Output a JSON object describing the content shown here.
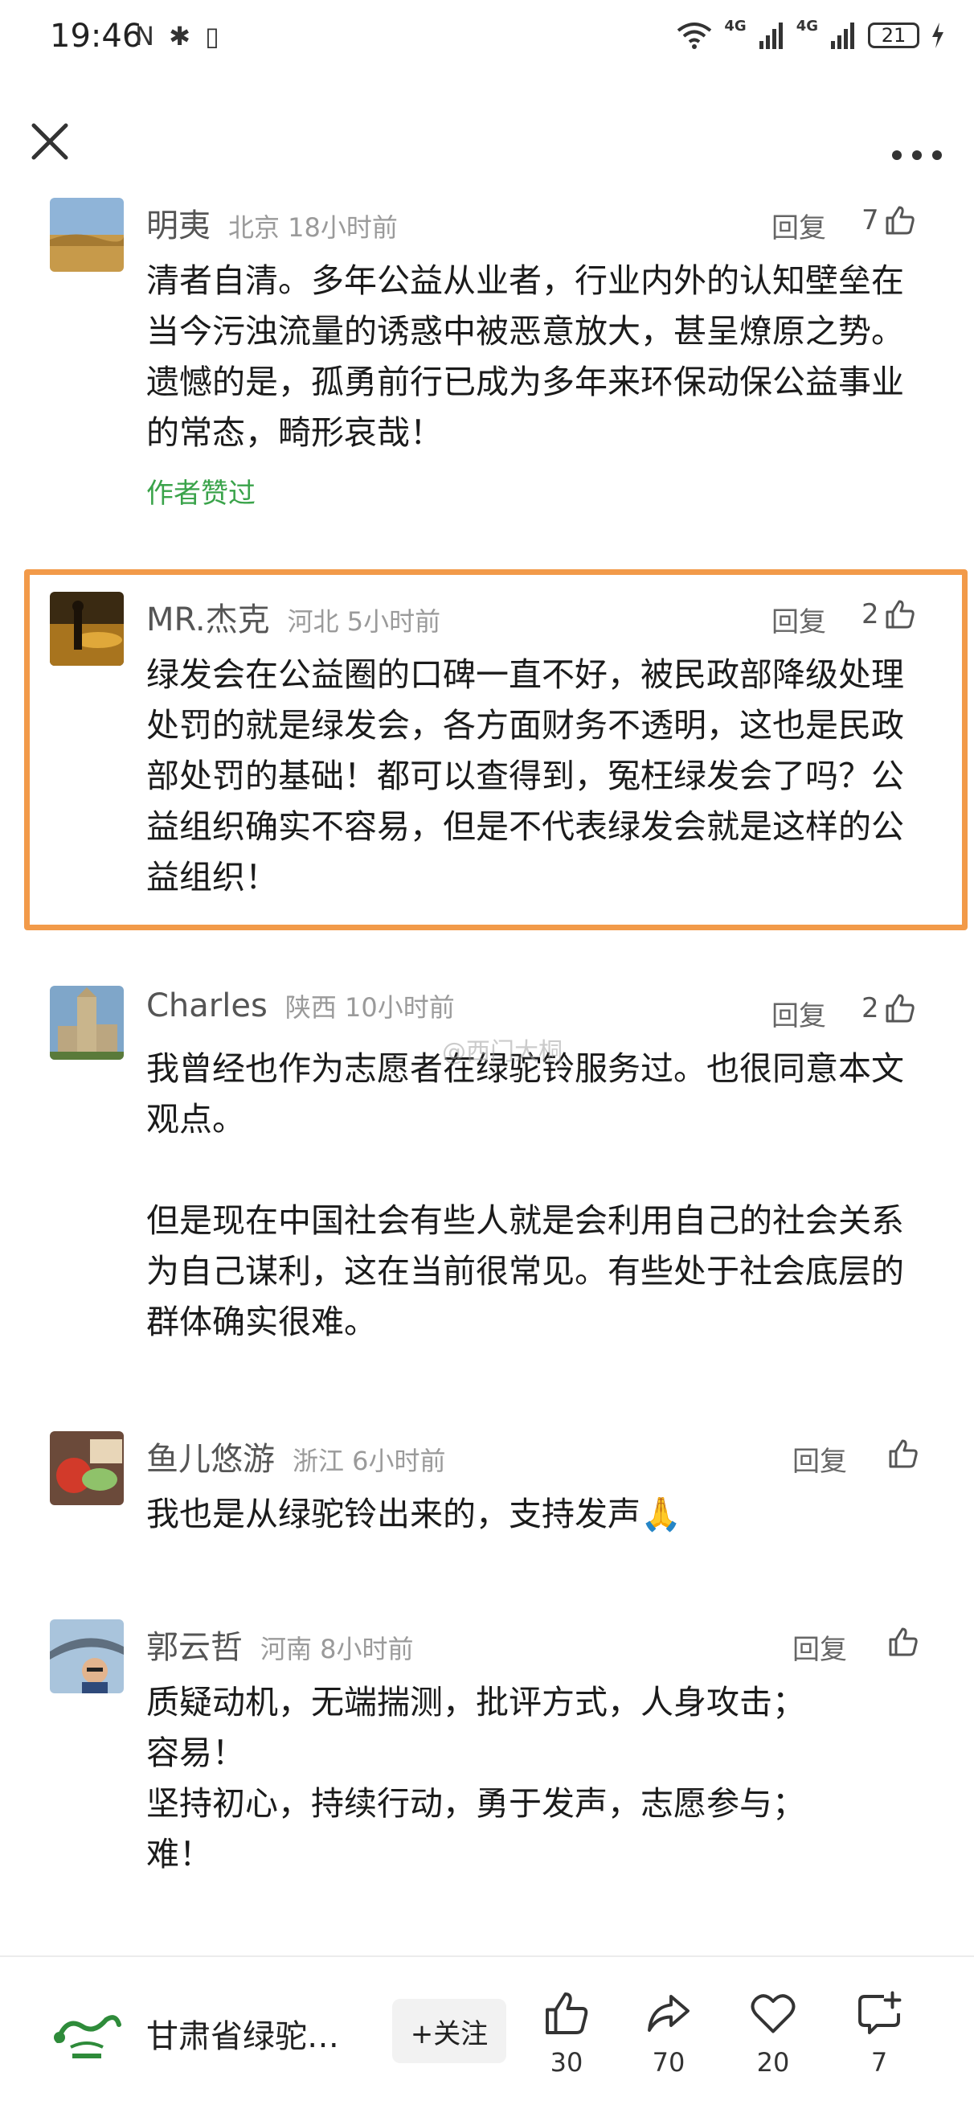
{
  "status_bar": {
    "time": "19:46",
    "left_icons": "N ✱ ▯",
    "network_1": "4G",
    "network_2": "4G",
    "battery": "21"
  },
  "comments": [
    {
      "name": "明夷",
      "location_time": "北京 18小时前",
      "reply_label": "回复",
      "like_count": "7",
      "text": "清者自清。多年公益从业者，行业内外的认知壁垒在当今污浊流量的诱惑中被恶意放大，甚呈燎原之势。遗憾的是，孤勇前行已成为多年来环保动保公益事业的常态，畸形哀哉！",
      "author_liked": "作者赞过"
    },
    {
      "name": "MR.杰克",
      "location_time": "河北 5小时前",
      "reply_label": "回复",
      "like_count": "2",
      "text": "绿发会在公益圈的口碑一直不好，被民政部降级处理处罚的就是绿发会，各方面财务不透明，这也是民政部处罚的基础！都可以查得到，冤枉绿发会了吗？公益组织确实不容易，但是不代表绿发会就是这样的公益组织！"
    },
    {
      "name": "Charles",
      "location_time": "陕西 10小时前",
      "reply_label": "回复",
      "like_count": "2",
      "text": "我曾经也作为志愿者在绿驼铃服务过。也很同意本文观点。\n\n但是现在中国社会有些人就是会利用自己的社会关系为自己谋利，这在当前很常见。有些处于社会底层的群体确实很难。"
    },
    {
      "name": "鱼儿悠游",
      "location_time": "浙江 6小时前",
      "reply_label": "回复",
      "like_count": "",
      "text": "我也是从绿驼铃出来的，支持发声🙏"
    },
    {
      "name": "郭云哲",
      "location_time": "河南 8小时前",
      "reply_label": "回复",
      "like_count": "",
      "text": "质疑动机，无端揣测，批评方式，人身攻击；\n容易！\n坚持初心，持续行动，勇于发声，志愿参与；\n难！"
    }
  ],
  "watermark": "@西门大桐",
  "bottom_bar": {
    "account_name": "甘肃省绿驼…",
    "follow_label": "+关注",
    "like_count": "30",
    "share_count": "70",
    "favorite_count": "20",
    "comment_count": "7"
  },
  "colors": {
    "highlight": "#f29a49",
    "author_liked": "#3aa34a"
  }
}
